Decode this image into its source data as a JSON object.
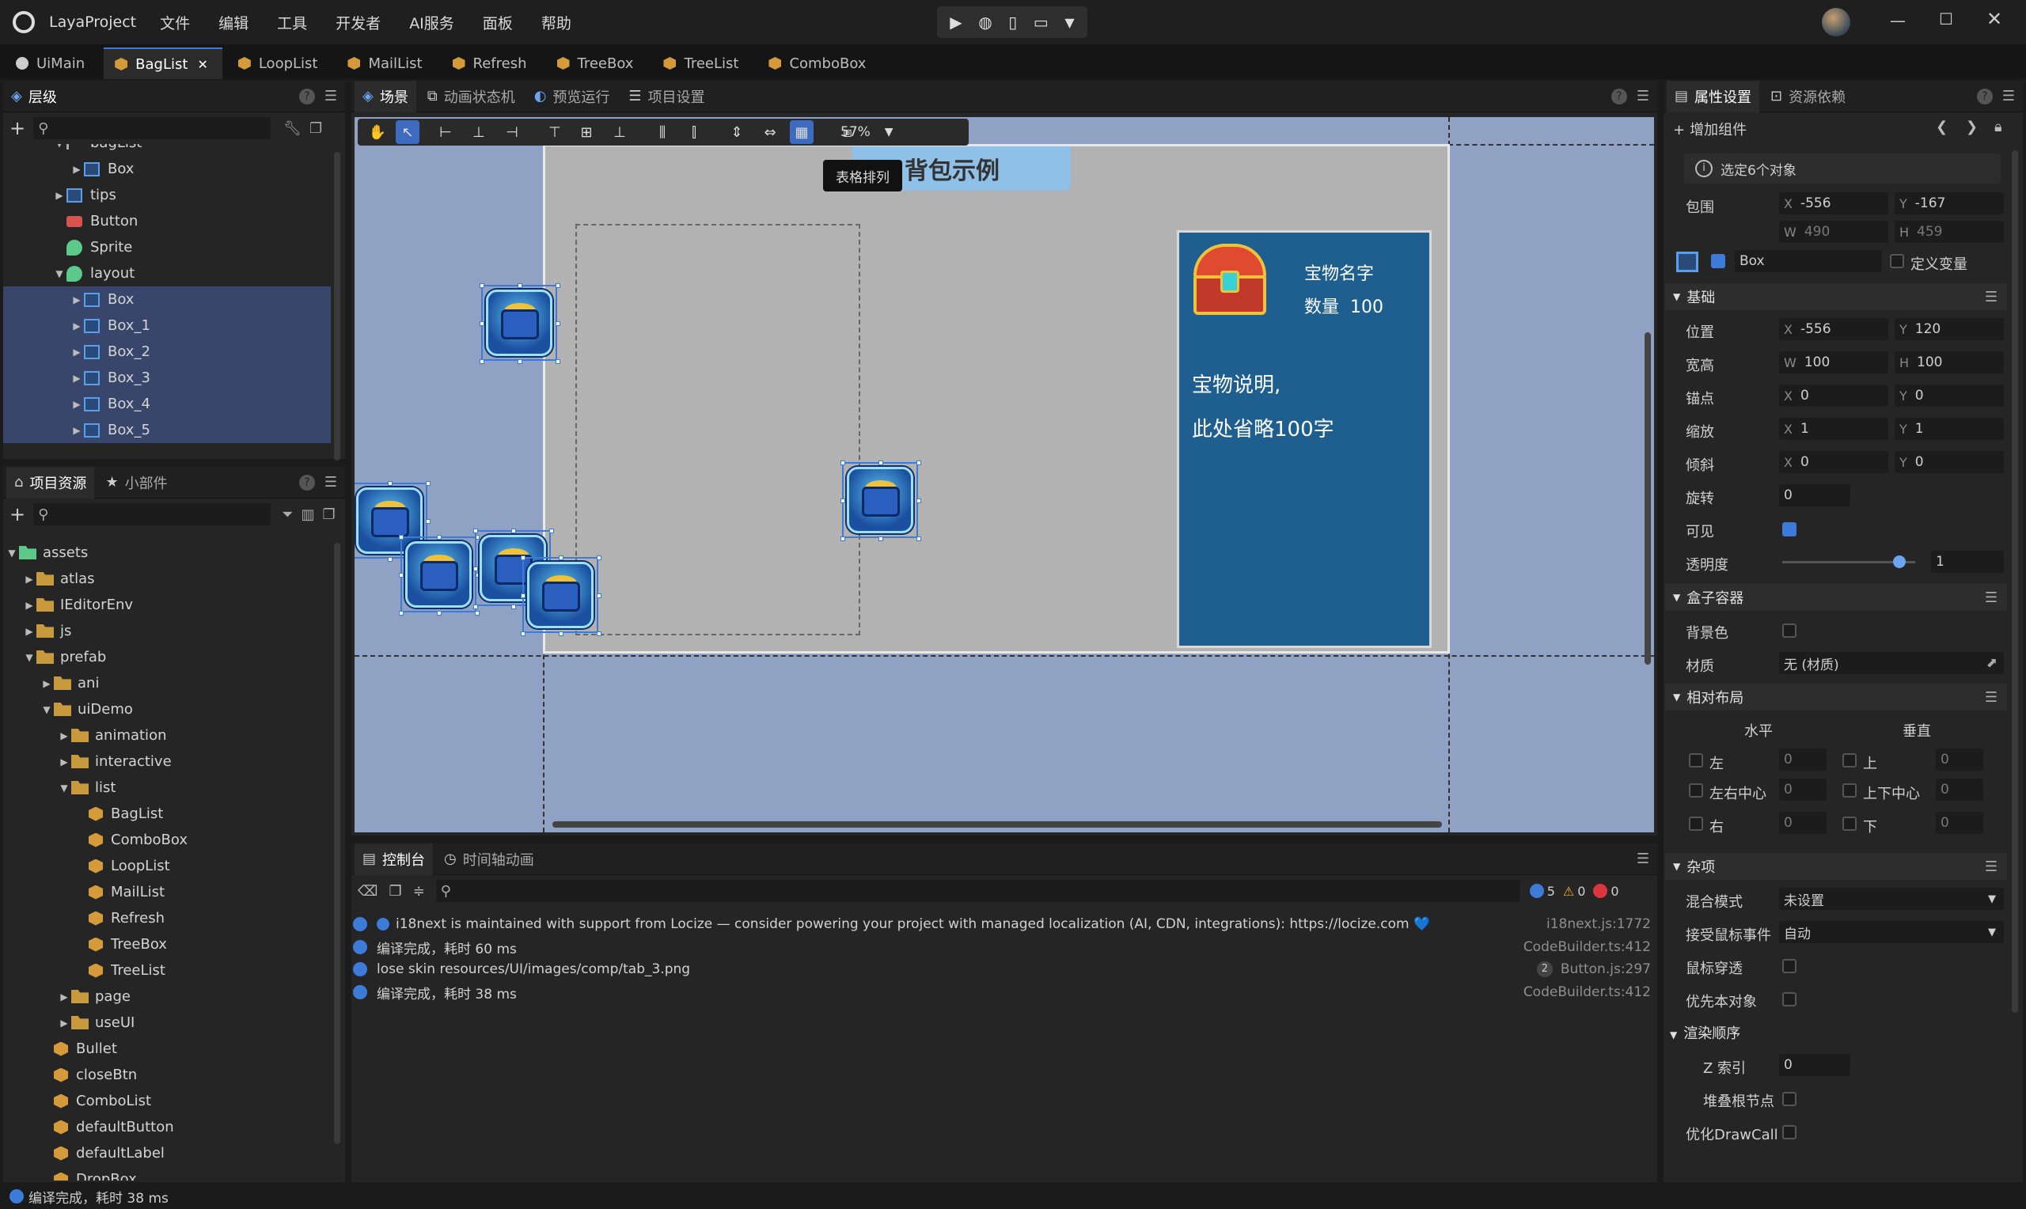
{
  "app": {
    "title": "LayaProject"
  },
  "menu": [
    "文件",
    "编辑",
    "工具",
    "开发者",
    "AI服务",
    "面板",
    "帮助"
  ],
  "file_tabs": [
    "UiMain",
    "BagList",
    "LoopList",
    "MailList",
    "Refresh",
    "TreeBox",
    "TreeList",
    "ComboBox"
  ],
  "hierarchy": {
    "title": "层级",
    "rows": [
      {
        "label": "bagList",
        "indent": 1
      },
      {
        "label": "Box",
        "indent": 2
      },
      {
        "label": "tips",
        "indent": 1
      },
      {
        "label": "Button",
        "indent": 1
      },
      {
        "label": "Sprite",
        "indent": 1
      },
      {
        "label": "layout",
        "indent": 1
      },
      {
        "label": "Box",
        "indent": 2
      },
      {
        "label": "Box_1",
        "indent": 2
      },
      {
        "label": "Box_2",
        "indent": 2
      },
      {
        "label": "Box_3",
        "indent": 2
      },
      {
        "label": "Box_4",
        "indent": 2
      },
      {
        "label": "Box_5",
        "indent": 2
      }
    ]
  },
  "assets": {
    "tab1": "项目资源",
    "tab2": "小部件",
    "rows": [
      {
        "label": "assets",
        "indent": 0
      },
      {
        "label": "atlas",
        "indent": 1
      },
      {
        "label": "IEditorEnv",
        "indent": 1
      },
      {
        "label": "js",
        "indent": 1
      },
      {
        "label": "prefab",
        "indent": 1
      },
      {
        "label": "ani",
        "indent": 2
      },
      {
        "label": "uiDemo",
        "indent": 2
      },
      {
        "label": "animation",
        "indent": 3
      },
      {
        "label": "interactive",
        "indent": 3
      },
      {
        "label": "list",
        "indent": 3
      },
      {
        "label": "BagList",
        "indent": 4
      },
      {
        "label": "ComboBox",
        "indent": 4
      },
      {
        "label": "LoopList",
        "indent": 4
      },
      {
        "label": "MailList",
        "indent": 4
      },
      {
        "label": "Refresh",
        "indent": 4
      },
      {
        "label": "TreeBox",
        "indent": 4
      },
      {
        "label": "TreeList",
        "indent": 4
      },
      {
        "label": "page",
        "indent": 3
      },
      {
        "label": "useUI",
        "indent": 3
      },
      {
        "label": "Bullet",
        "indent": 2
      },
      {
        "label": "closeBtn",
        "indent": 2
      },
      {
        "label": "ComboList",
        "indent": 2
      },
      {
        "label": "defaultButton",
        "indent": 2
      },
      {
        "label": "defaultLabel",
        "indent": 2
      },
      {
        "label": "DropBox",
        "indent": 2
      }
    ]
  },
  "scene_tabs": [
    "场景",
    "动画状态机",
    "预览运行",
    "项目设置"
  ],
  "zoom": "57%",
  "tooltip": "表格排列",
  "scene": {
    "title": "背包示例",
    "item_name": "宝物名字",
    "quantity": "数量  100",
    "desc1": "宝物说明,",
    "desc2": "此处省略100字"
  },
  "console": {
    "tab1": "控制台",
    "tab2": "时间轴动画",
    "counts": {
      "info": "5",
      "warn": "0",
      "error": "0"
    },
    "logs": [
      {
        "text": "i18next is maintained with support from Locize — consider powering your project with managed localization (AI, CDN, integrations): https://locize.com 💙",
        "src": "i18next.js:1772"
      },
      {
        "text": "编译完成，耗时 60 ms",
        "src": "CodeBuilder.ts:412"
      },
      {
        "text": "lose skin resources/UI/images/comp/tab_3.png",
        "src": "Button.js:297",
        "badge": "2"
      },
      {
        "text": "编译完成，耗时 38 ms",
        "src": "CodeBuilder.ts:412"
      }
    ]
  },
  "props": {
    "tab1": "属性设置",
    "tab2": "资源依赖",
    "add_component": "增加组件",
    "selected": "选定6个对象",
    "bounds": {
      "label": "包围",
      "x": "-556",
      "y": "-167",
      "w": "490",
      "h": "459"
    },
    "node_name": "Box",
    "define_var": "定义变量",
    "sec_basic": "基础",
    "position": {
      "label": "位置",
      "x": "-556",
      "y": "120"
    },
    "size": {
      "label": "宽高",
      "w": "100",
      "h": "100"
    },
    "anchor": {
      "label": "锚点",
      "x": "0",
      "y": "0"
    },
    "scale": {
      "label": "缩放",
      "x": "1",
      "y": "1"
    },
    "skew": {
      "label": "倾斜",
      "x": "0",
      "y": "0"
    },
    "rotation": {
      "label": "旋转",
      "value": "0"
    },
    "visible": "可见",
    "alpha": {
      "label": "透明度",
      "value": "1",
      "level": 1
    },
    "sec_box": "盒子容器",
    "bgcolor": "背景色",
    "material": {
      "label": "材质",
      "value": "无 (材质)"
    },
    "sec_layout": "相对布局",
    "horizontal": "水平",
    "vertical": "垂直",
    "left": "左",
    "centerx": "左右中心",
    "right": "右",
    "top": "上",
    "centery": "上下中心",
    "bottom": "下",
    "zero": "0",
    "sec_misc": "杂项",
    "blend": {
      "label": "混合模式",
      "value": "未设置"
    },
    "mouse": {
      "label": "接受鼠标事件",
      "value": "自动"
    },
    "through": "鼠标穿透",
    "priority": "优先本对象",
    "sec_render": "渲染顺序",
    "zindex": {
      "label": "Z 索引",
      "value": "0"
    },
    "stack_root": "堆叠根节点",
    "drawcall": "优化DrawCall"
  },
  "status": "编译完成，耗时 38 ms",
  "colors": {
    "accent": "#3d7bd9",
    "scene_bg": "#8fa2c4",
    "item_panel": "#1f5f8f"
  }
}
